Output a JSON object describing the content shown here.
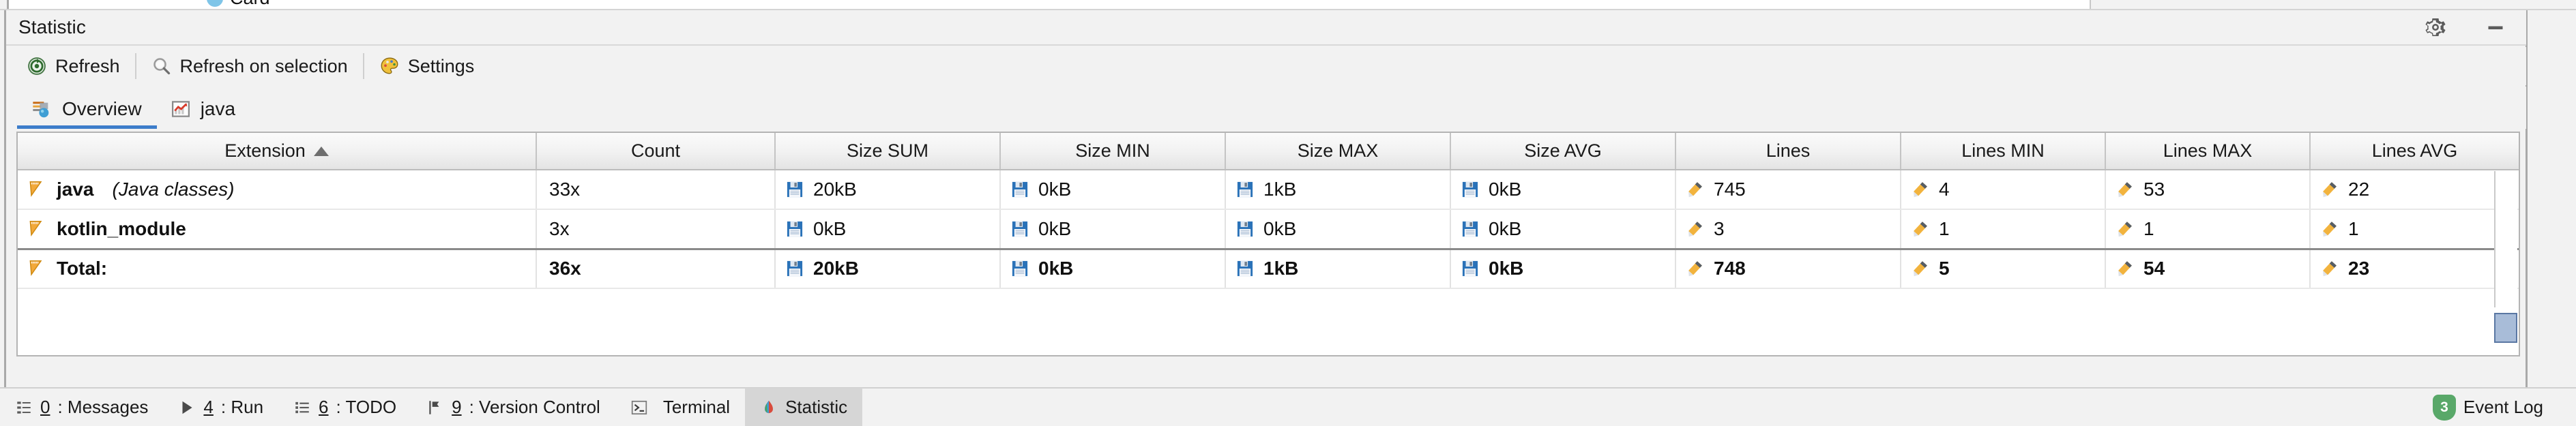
{
  "editor_tab_sliver": {
    "label": "Card"
  },
  "toolwindow": {
    "title": "Statistic",
    "actions": [
      {
        "name": "settings-gear",
        "icon": "gear-icon"
      },
      {
        "name": "hide-window",
        "icon": "minimize-icon"
      }
    ],
    "toolbar": [
      {
        "label": "Refresh",
        "icon": "refresh-icon"
      },
      {
        "label": "Refresh on selection",
        "icon": "magnifier-icon"
      },
      {
        "label": "Settings",
        "icon": "palette-icon"
      }
    ],
    "tabs": [
      {
        "label": "Overview",
        "icon": "overview-icon",
        "active": true
      },
      {
        "label": "java",
        "icon": "chart-icon",
        "active": false
      }
    ]
  },
  "table": {
    "sort_column": "Extension",
    "sort_direction": "asc",
    "columns": [
      "Extension",
      "Count",
      "Size SUM",
      "Size MIN",
      "Size MAX",
      "Size AVG",
      "Lines",
      "Lines MIN",
      "Lines MAX",
      "Lines AVG"
    ],
    "rows": [
      {
        "icon": "ruler-icon",
        "extension": "java",
        "extension_desc": "(Java classes)",
        "count": "33x",
        "size_sum": "20kB",
        "size_min": "0kB",
        "size_max": "1kB",
        "size_avg": "0kB",
        "lines": "745",
        "lines_min": "4",
        "lines_max": "53",
        "lines_avg": "22"
      },
      {
        "icon": "ruler-icon",
        "extension": "kotlin_module",
        "extension_desc": "",
        "count": "3x",
        "size_sum": "0kB",
        "size_min": "0kB",
        "size_max": "0kB",
        "size_avg": "0kB",
        "lines": "3",
        "lines_min": "1",
        "lines_max": "1",
        "lines_avg": "1"
      }
    ],
    "total": {
      "icon": "ruler-icon",
      "extension": "Total:",
      "count": "36x",
      "size_sum": "20kB",
      "size_min": "0kB",
      "size_max": "1kB",
      "size_avg": "0kB",
      "lines": "748",
      "lines_min": "5",
      "lines_max": "54",
      "lines_avg": "23"
    }
  },
  "statusbar": {
    "items": [
      {
        "mnemonic": "0",
        "label": ": Messages",
        "icon": "messages-icon",
        "selected": false
      },
      {
        "mnemonic": "4",
        "label": ": Run",
        "icon": "run-icon",
        "selected": false
      },
      {
        "mnemonic": "6",
        "label": ": TODO",
        "icon": "todo-icon",
        "selected": false
      },
      {
        "mnemonic": "9",
        "label": ": Version Control",
        "icon": "branch-icon",
        "selected": false
      },
      {
        "mnemonic": "",
        "label": "Terminal",
        "icon": "terminal-icon",
        "selected": false
      },
      {
        "mnemonic": "",
        "label": "Statistic",
        "icon": "statistic-icon",
        "selected": true
      }
    ],
    "event_log": {
      "label": "Event Log",
      "count": "3"
    }
  },
  "colors": {
    "accent": "#3d7dca",
    "badge_green": "#59a869",
    "panel_bg": "#f2f2f2",
    "table_bg": "#ffffff",
    "selection_blue": "#a8bcd8"
  }
}
